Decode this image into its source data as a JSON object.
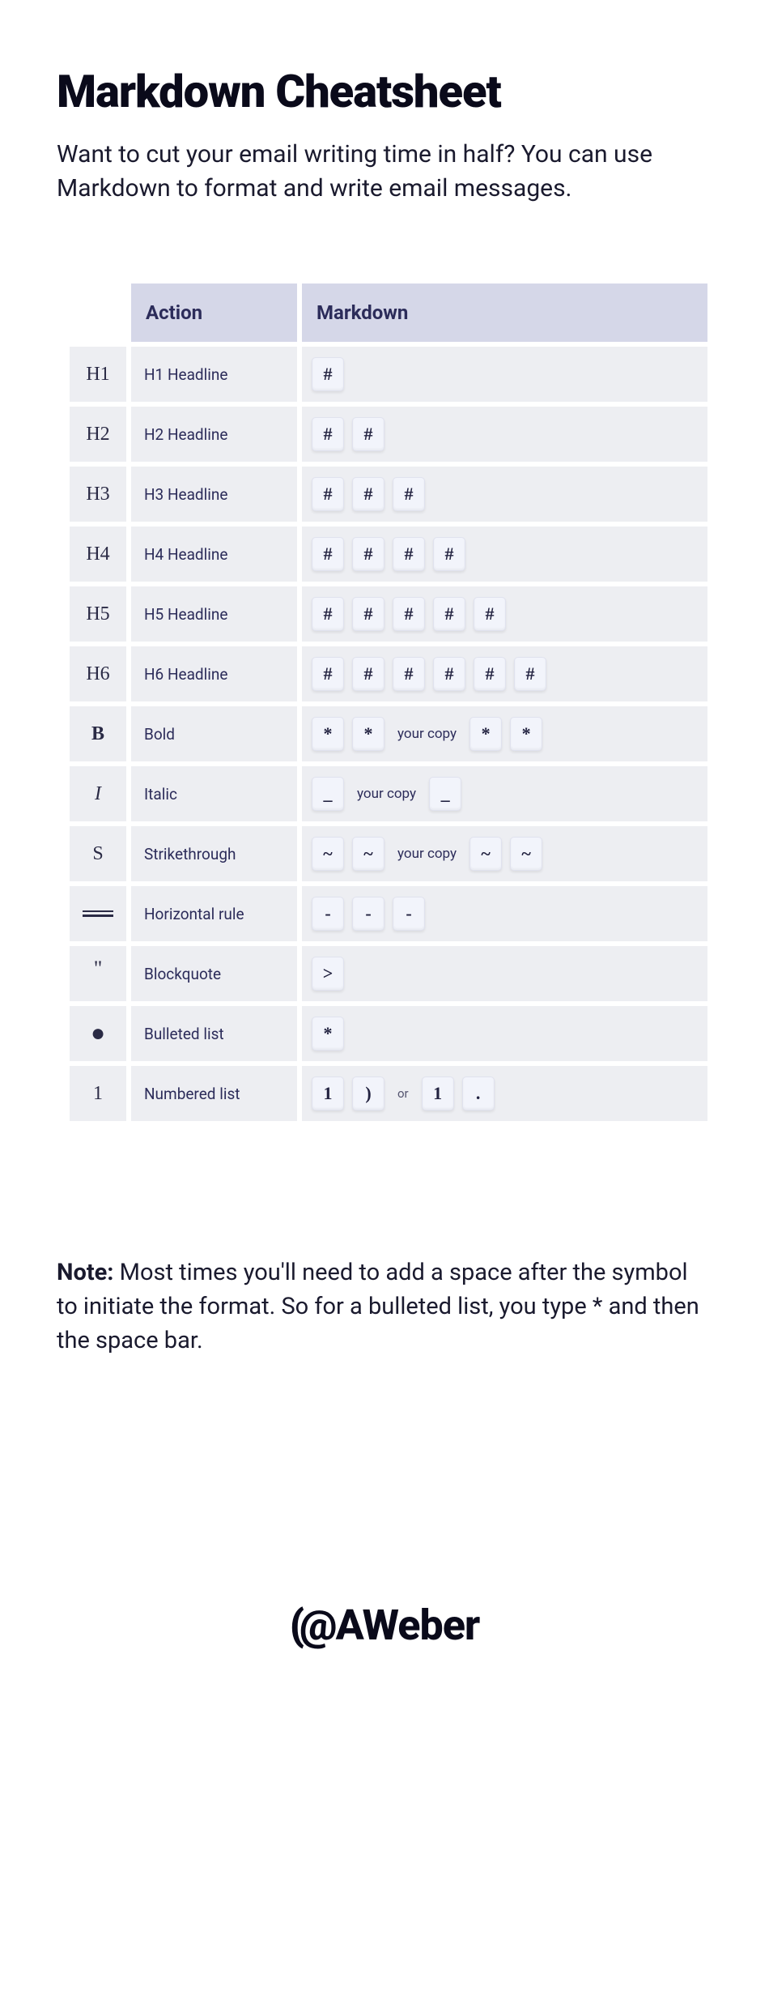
{
  "title": "Markdown Cheatsheet",
  "intro": "Want to cut your email writing time in half? You can use Markdown to format and write email messages.",
  "headers": {
    "action": "Action",
    "markdown": "Markdown"
  },
  "rows": [
    {
      "icon": "H1",
      "action": "H1 Headline",
      "md": [
        {
          "t": "k",
          "v": "#"
        }
      ]
    },
    {
      "icon": "H2",
      "action": "H2 Headline",
      "md": [
        {
          "t": "k",
          "v": "#"
        },
        {
          "t": "k",
          "v": "#"
        }
      ]
    },
    {
      "icon": "H3",
      "action": "H3 Headline",
      "md": [
        {
          "t": "k",
          "v": "#"
        },
        {
          "t": "k",
          "v": "#"
        },
        {
          "t": "k",
          "v": "#"
        }
      ]
    },
    {
      "icon": "H4",
      "action": "H4 Headline",
      "md": [
        {
          "t": "k",
          "v": "#"
        },
        {
          "t": "k",
          "v": "#"
        },
        {
          "t": "k",
          "v": "#"
        },
        {
          "t": "k",
          "v": "#"
        }
      ]
    },
    {
      "icon": "H5",
      "action": "H5 Headline",
      "md": [
        {
          "t": "k",
          "v": "#"
        },
        {
          "t": "k",
          "v": "#"
        },
        {
          "t": "k",
          "v": "#"
        },
        {
          "t": "k",
          "v": "#"
        },
        {
          "t": "k",
          "v": "#"
        }
      ]
    },
    {
      "icon": "H6",
      "action": "H6 Headline",
      "md": [
        {
          "t": "k",
          "v": "#"
        },
        {
          "t": "k",
          "v": "#"
        },
        {
          "t": "k",
          "v": "#"
        },
        {
          "t": "k",
          "v": "#"
        },
        {
          "t": "k",
          "v": "#"
        },
        {
          "t": "k",
          "v": "#"
        }
      ]
    },
    {
      "icon": "B",
      "iconClass": "bold-icon",
      "action": "Bold",
      "md": [
        {
          "t": "k",
          "v": "*"
        },
        {
          "t": "k",
          "v": "*"
        },
        {
          "t": "txt",
          "v": "your copy"
        },
        {
          "t": "k",
          "v": "*"
        },
        {
          "t": "k",
          "v": "*"
        }
      ]
    },
    {
      "icon": "I",
      "iconClass": "italic-icon",
      "action": "Italic",
      "md": [
        {
          "t": "k",
          "v": "_"
        },
        {
          "t": "txt",
          "v": "your copy"
        },
        {
          "t": "k",
          "v": "_"
        }
      ]
    },
    {
      "icon": "S",
      "iconClass": "strike-icon",
      "action": "Strikethrough",
      "md": [
        {
          "t": "k",
          "v": "~"
        },
        {
          "t": "k",
          "v": "~"
        },
        {
          "t": "txt",
          "v": "your copy"
        },
        {
          "t": "k",
          "v": "~"
        },
        {
          "t": "k",
          "v": "~"
        }
      ]
    },
    {
      "icon": "hr",
      "action": "Horizontal rule",
      "md": [
        {
          "t": "k",
          "v": "-"
        },
        {
          "t": "k",
          "v": "-"
        },
        {
          "t": "k",
          "v": "-"
        }
      ]
    },
    {
      "icon": "\"",
      "iconClass": "quote-icon",
      "action": "Blockquote",
      "md": [
        {
          "t": "k",
          "v": ">"
        }
      ]
    },
    {
      "icon": "●",
      "iconClass": "bullet-icon",
      "action": "Bulleted list",
      "md": [
        {
          "t": "k",
          "v": "*"
        }
      ]
    },
    {
      "icon": "1",
      "action": "Numbered list",
      "md": [
        {
          "t": "k",
          "v": "1"
        },
        {
          "t": "k",
          "v": ")"
        },
        {
          "t": "or",
          "v": "or"
        },
        {
          "t": "k",
          "v": "1"
        },
        {
          "t": "k",
          "v": "."
        }
      ]
    }
  ],
  "note_label": "Note:",
  "note_body": " Most times you'll need to add a space after the symbol to initiate the format. So for a bulleted list, you type * and then the space bar.",
  "logo": "AWeber"
}
